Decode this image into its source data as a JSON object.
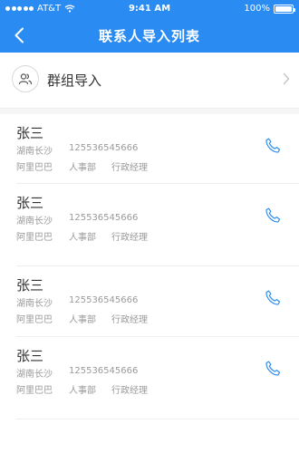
{
  "status_bar": {
    "carrier": "AT&T",
    "time": "9:41 AM",
    "battery": "100%"
  },
  "nav": {
    "title": "联系人导入列表"
  },
  "group_import": {
    "label": "群组导入"
  },
  "contacts": [
    {
      "name": "张三",
      "city": "湖南长沙",
      "phone": "125536545666",
      "company": "阿里巴巴",
      "department": "人事部",
      "position": "行政经理"
    },
    {
      "name": "张三",
      "city": "湖南长沙",
      "phone": "125536545666",
      "company": "阿里巴巴",
      "department": "人事部",
      "position": "行政经理"
    },
    {
      "name": "张三",
      "city": "湖南长沙",
      "phone": "125536545666",
      "company": "阿里巴巴",
      "department": "人事部",
      "position": "行政经理"
    },
    {
      "name": "张三",
      "city": "湖南长沙",
      "phone": "125536545666",
      "company": "阿里巴巴",
      "department": "人事部",
      "position": "行政经理"
    }
  ],
  "colors": {
    "accent": "#2a8bf2",
    "text_primary": "#333333",
    "text_secondary": "#9a9a9a"
  }
}
